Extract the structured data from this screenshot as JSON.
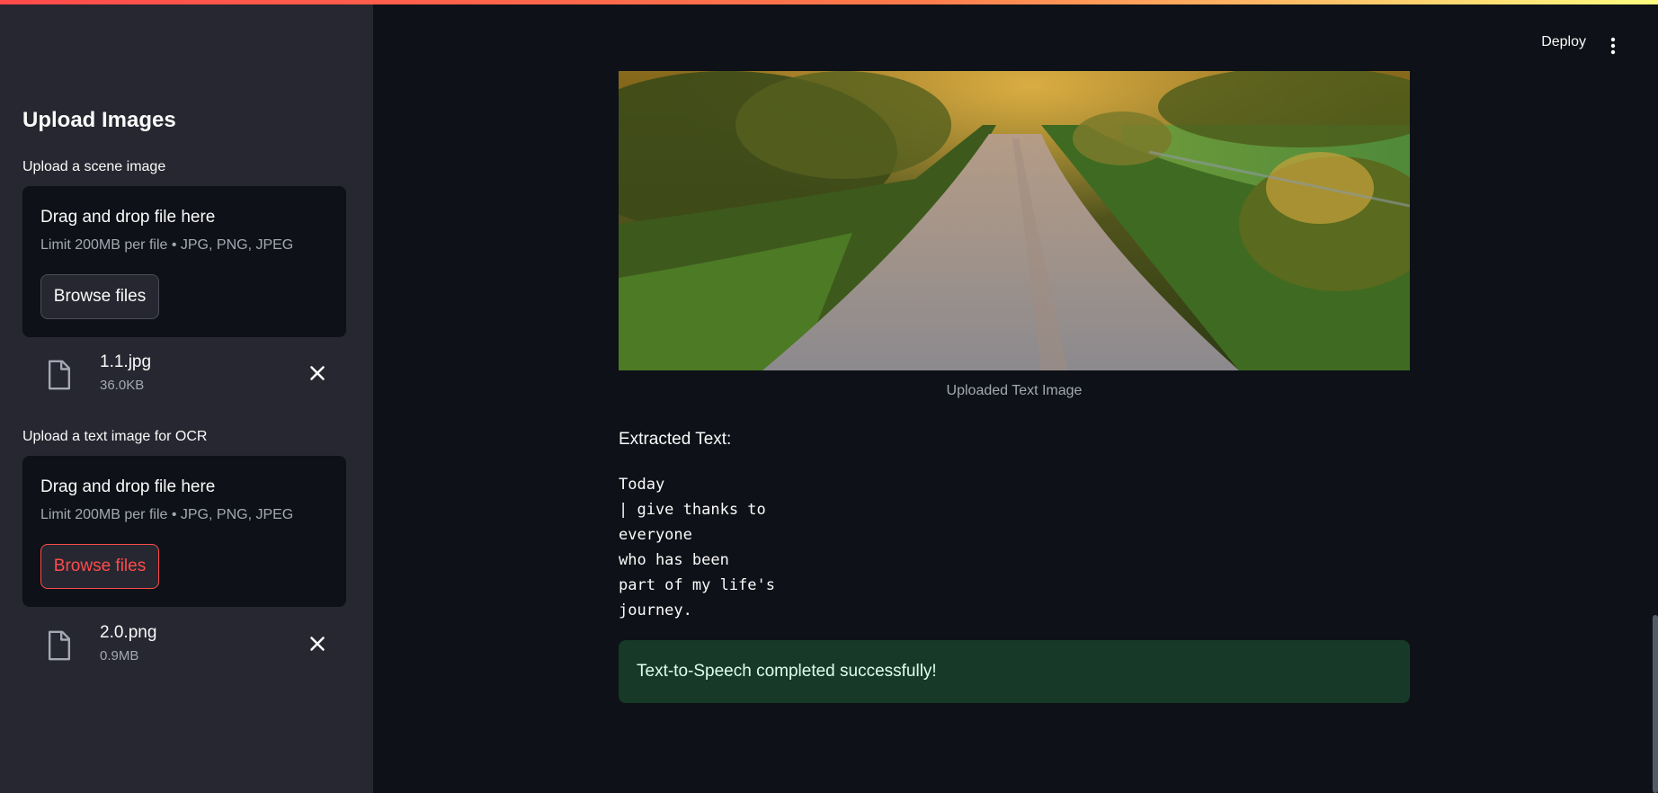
{
  "sidebar": {
    "title": "Upload Images",
    "uploaders": [
      {
        "label": "Upload a scene image",
        "dropzone_title": "Drag and drop file here",
        "dropzone_limit": "Limit 200MB per file • JPG, PNG, JPEG",
        "browse_label": "Browse files",
        "file": {
          "name": "1.1.jpg",
          "size": "36.0KB"
        }
      },
      {
        "label": "Upload a text image for OCR",
        "dropzone_title": "Drag and drop file here",
        "dropzone_limit": "Limit 200MB per file • JPG, PNG, JPEG",
        "browse_label": "Browse files",
        "file": {
          "name": "2.0.png",
          "size": "0.9MB"
        }
      }
    ]
  },
  "header": {
    "deploy_label": "Deploy",
    "menu_icon": "vertical-ellipsis-icon"
  },
  "main": {
    "image_caption": "Uploaded Text Image",
    "extracted_heading": "Extracted Text:",
    "extracted_lines": [
      "Today",
      "| give thanks to",
      "everyone",
      "who has been",
      "part of my life's",
      "journey."
    ],
    "success_message": "Text-to-Speech completed successfully!"
  },
  "colors": {
    "background": "#0e1117",
    "sidebar": "#262730",
    "accent": "#ff4b4b",
    "success_bg": "#173928",
    "success_text": "#dffde9"
  }
}
